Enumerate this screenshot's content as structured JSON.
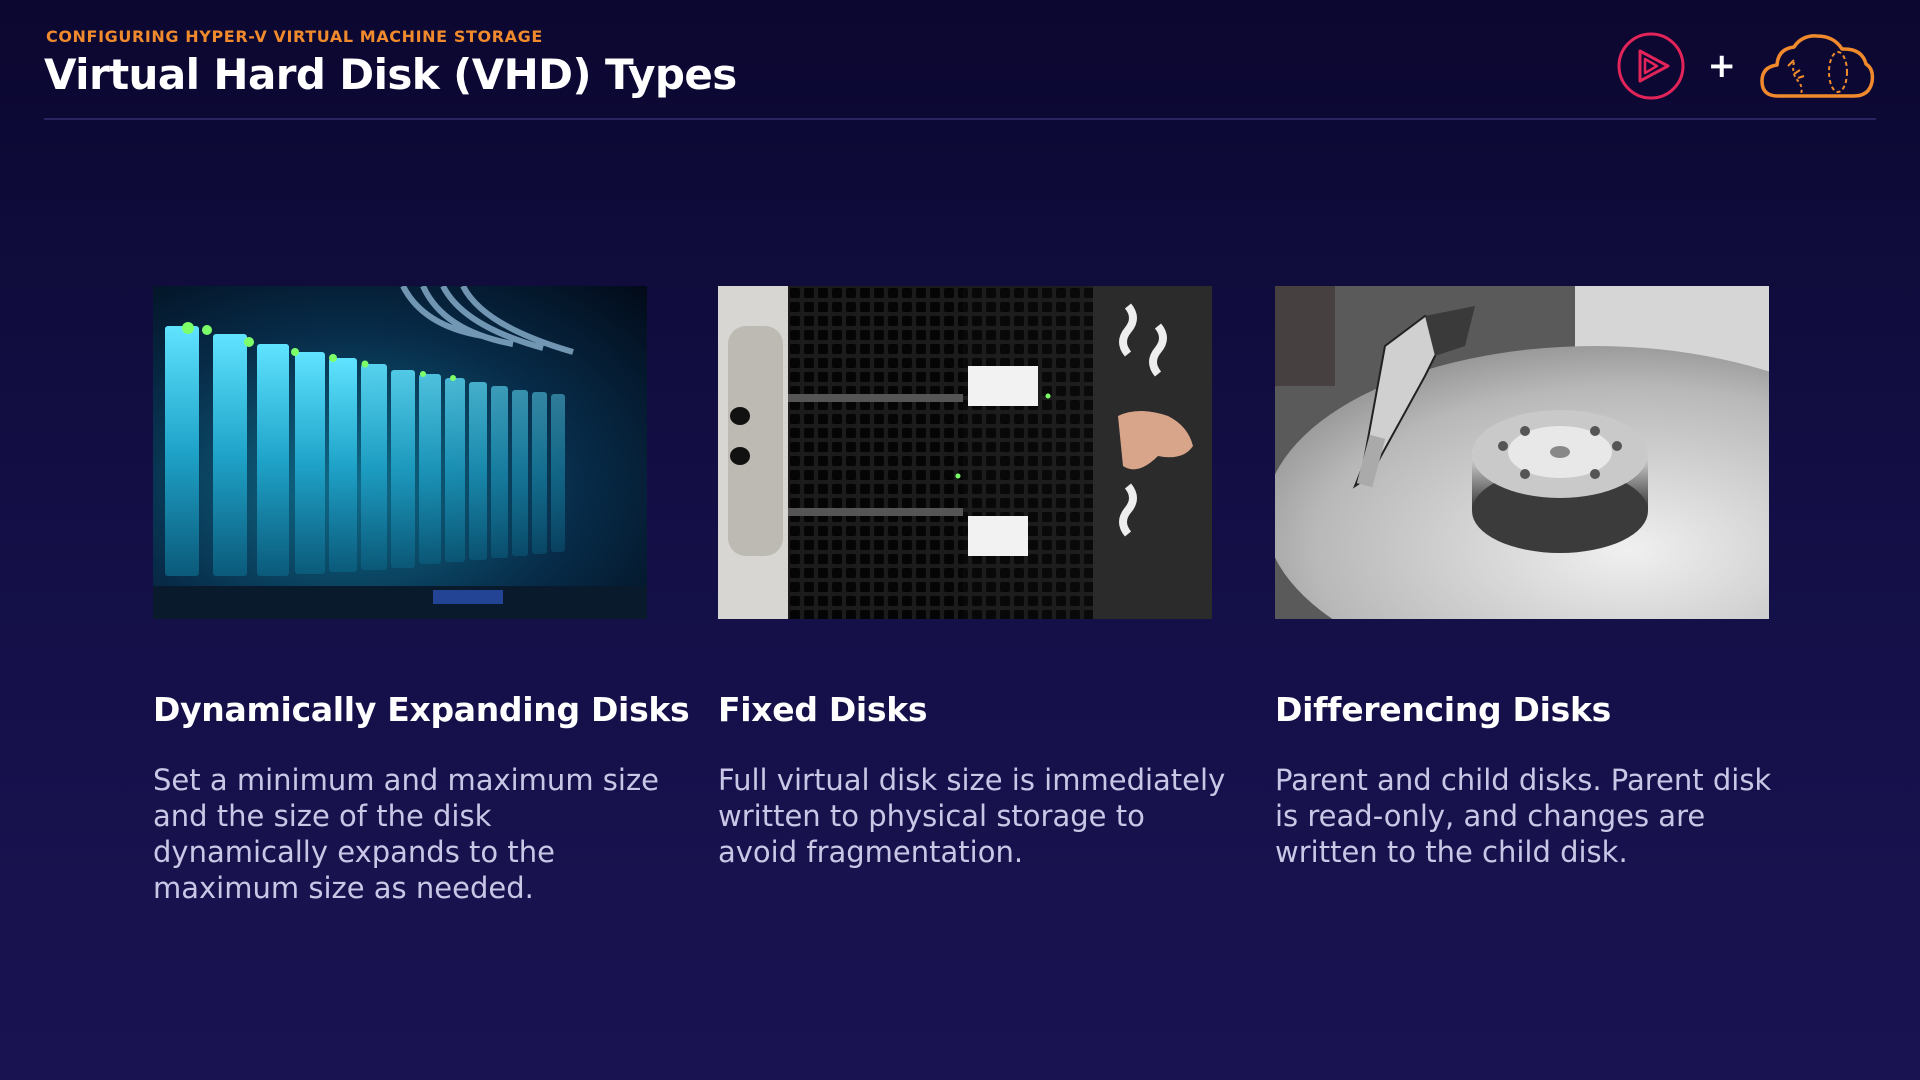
{
  "header": {
    "eyebrow": "CONFIGURING HYPER-V VIRTUAL MACHINE STORAGE",
    "title": "Virtual Hard Disk (VHD) Types",
    "logos": [
      "play-logo-icon",
      "cloud-logo-icon"
    ],
    "plus": "+"
  },
  "colors": {
    "accent_orange": "#f08a2c",
    "accent_red": "#e3245a",
    "background": "#130f45",
    "body_text": "#c9c6e6"
  },
  "cards": [
    {
      "image": "server-rack-blue-photo",
      "heading": "Dynamically Expanding Disks",
      "text": "Set a minimum and maximum size and the size of the disk dynamically expands to the maximum size as needed."
    },
    {
      "image": "server-rack-hand-photo",
      "heading": "Fixed Disks",
      "text": "Full virtual disk size is immediately written to physical storage to avoid fragmentation."
    },
    {
      "image": "hard-drive-platter-photo",
      "heading": "Differencing Disks",
      "text": "Parent and child disks. Parent disk is read-only, and changes are written to the child disk."
    }
  ]
}
